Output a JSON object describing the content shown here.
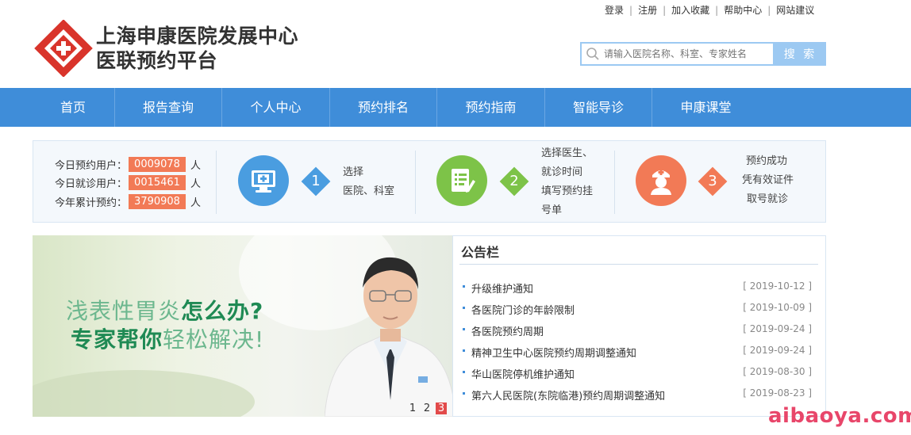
{
  "top_links": [
    "登录",
    "注册",
    "加入收藏",
    "帮助中心",
    "网站建议"
  ],
  "logo": {
    "line1": "上海申康医院发展中心",
    "line2": "医联预约平台",
    "color_red": "#d9342b",
    "icon": "cross-diamond-logo"
  },
  "search": {
    "placeholder": "请输入医院名称、科室、专家姓名",
    "button": "搜 索",
    "icon": "search-icon"
  },
  "nav": {
    "items": [
      "首页",
      "报告查询",
      "个人中心",
      "预约排名",
      "预约指南",
      "智能导诊",
      "申康课堂"
    ],
    "color": "#3f8dd9"
  },
  "stats": {
    "rows": [
      {
        "label": "今日预约用户：",
        "value": "0009078",
        "unit": "人"
      },
      {
        "label": "今日就诊用户：",
        "value": "0015461",
        "unit": "人"
      },
      {
        "label": "今年累计预约：",
        "value": "3790908",
        "unit": "人"
      }
    ],
    "value_color": "#f27a56"
  },
  "steps": [
    {
      "num": "1",
      "icon": "monitor-hospital-icon",
      "color": "#4a9de0",
      "lines": [
        "选择",
        "医院、科室"
      ]
    },
    {
      "num": "2",
      "icon": "form-pencil-icon",
      "color": "#7dc348",
      "lines": [
        "选择医生、",
        "就诊时间",
        "填写预约挂",
        "号单"
      ]
    },
    {
      "num": "3",
      "icon": "nurse-icon",
      "color": "#f27a56",
      "lines": [
        "预约成功",
        "凭有效证件",
        "取号就诊"
      ]
    }
  ],
  "banner": {
    "line1_a": "浅表性胃炎",
    "line1_b": "怎么办?",
    "line2_a": "专家帮你",
    "line2_b": "轻松解决!",
    "dots": [
      "1",
      "2",
      "3"
    ],
    "active_dot": "3"
  },
  "notice": {
    "title": "公告栏",
    "items": [
      {
        "text": "升级维护通知",
        "date": "[ 2019-10-12 ]"
      },
      {
        "text": "各医院门诊的年龄限制",
        "date": "[ 2019-10-09 ]"
      },
      {
        "text": "各医院预约周期",
        "date": "[ 2019-09-24 ]"
      },
      {
        "text": "精神卫生中心医院预约周期调整通知",
        "date": "[ 2019-09-24 ]"
      },
      {
        "text": "华山医院停机维护通知",
        "date": "[ 2019-08-30 ]"
      },
      {
        "text": "第六人民医院(东院临港)预约周期调整通知",
        "date": "[ 2019-08-23 ]"
      }
    ]
  },
  "watermark": "aibaoya.com"
}
